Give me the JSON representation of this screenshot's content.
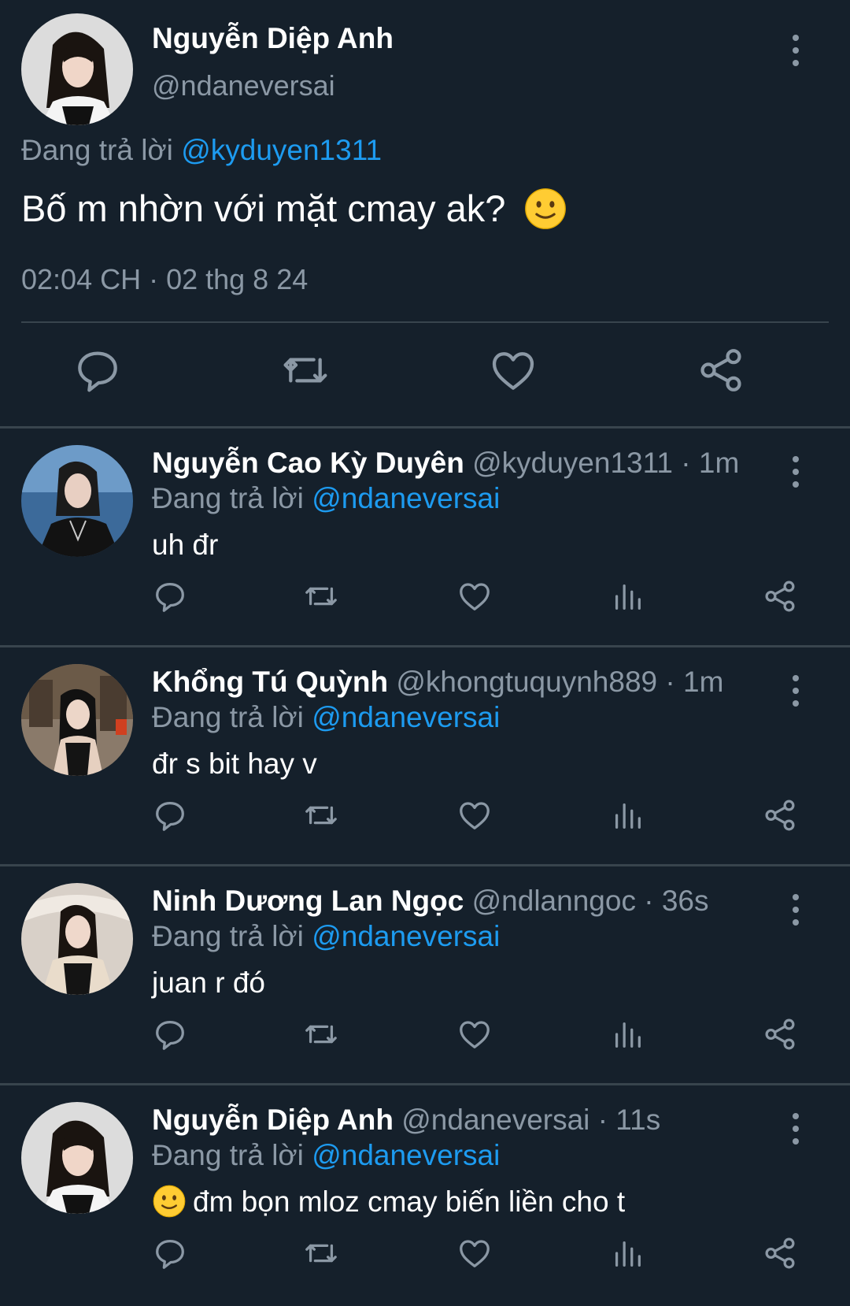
{
  "main_tweet": {
    "name": "Nguyễn Diệp Anh",
    "handle": "@ndaneversai",
    "replying_prefix": "Đang trả lời",
    "replying_to": "@kyduyen1311",
    "text": "Bố m nhờn với mặt cmay ak?",
    "timestamp": "02:04 CH · 02 thg 8 24",
    "actions": [
      "reply-icon",
      "retweet-icon",
      "like-icon",
      "share-icon"
    ]
  },
  "replies": [
    {
      "name": "Nguyễn Cao Kỳ Duyên",
      "handle": "@kyduyen1311",
      "time": "· 1m",
      "replying_prefix": "Đang trả lời",
      "replying_to": "@ndaneversai",
      "text": "uh đr"
    },
    {
      "name": "Khổng Tú Quỳnh",
      "handle": "@khongtuquynh889",
      "time": "· 1m",
      "replying_prefix": "Đang trả lời",
      "replying_to": "@ndaneversai",
      "text": "đr s bit hay v"
    },
    {
      "name": "Ninh Dương Lan Ngọc",
      "handle": "@ndlanngoc",
      "time": "· 36s",
      "replying_prefix": "Đang trả lời",
      "replying_to": "@ndaneversai",
      "text": "juan r đó"
    },
    {
      "name": "Nguyễn Diệp Anh",
      "handle": "@ndaneversai",
      "time": "· 11s",
      "replying_prefix": "Đang trả lời",
      "replying_to": "@ndaneversai",
      "text": "đm bọn mloz cmay biến liền cho t"
    }
  ],
  "colors": {
    "background": "#15202b",
    "text": "#ffffff",
    "muted": "#8b98a5",
    "link": "#1d9bf0",
    "divider": "#38444d"
  }
}
